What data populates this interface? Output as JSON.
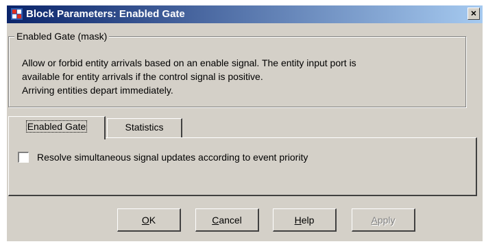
{
  "window": {
    "title": "Block Parameters: Enabled Gate",
    "close_glyph": "×",
    "icon": "simulink-block-icon"
  },
  "mask": {
    "group_title": "Enabled Gate (mask)",
    "description_lines": [
      "Allow or forbid entity arrivals based on an enable signal. The entity input port is",
      "available for entity arrivals if the control signal is positive.",
      "Arriving entities depart immediately."
    ]
  },
  "tabs": [
    {
      "label": "Enabled Gate",
      "active": true
    },
    {
      "label": "Statistics",
      "active": false
    }
  ],
  "options": {
    "resolve_label": "Resolve simultaneous signal updates according to event priority",
    "resolve_checked": false
  },
  "buttons": {
    "ok": {
      "mnemonic": "O",
      "rest": "K",
      "enabled": true
    },
    "cancel": {
      "mnemonic": "C",
      "rest": "ancel",
      "enabled": true
    },
    "help": {
      "mnemonic": "H",
      "rest": "elp",
      "enabled": true
    },
    "apply": {
      "mnemonic": "A",
      "rest": "pply",
      "enabled": false
    }
  },
  "colors": {
    "title_gradient_start": "#0a246a",
    "title_gradient_end": "#a6caf0",
    "face": "#d4d0c8"
  }
}
